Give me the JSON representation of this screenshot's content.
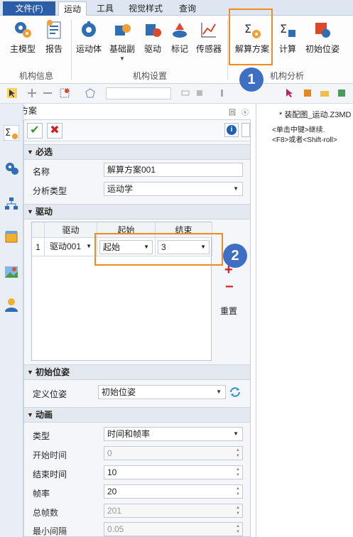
{
  "menu": {
    "file": "文件(F)",
    "tabs": [
      "运动",
      "工具",
      "视觉样式",
      "查询"
    ]
  },
  "ribbon": {
    "groups": [
      {
        "label": "机构信息",
        "buttons": [
          "主模型",
          "报告"
        ]
      },
      {
        "label": "机构设置",
        "buttons": [
          "运动体",
          "基础副",
          "驱动",
          "标记",
          "传感器"
        ]
      },
      {
        "label": "机构分析",
        "buttons": [
          "解算方案",
          "计算",
          "初始位姿"
        ]
      }
    ]
  },
  "panel": {
    "title": "解算方案",
    "controls": {
      "pin": "回",
      "close": "ⓧ"
    },
    "required": {
      "header": "必选",
      "name_label": "名称",
      "name_value": "解算方案001",
      "type_label": "分析类型",
      "type_value": "运动学"
    },
    "drive": {
      "header": "驱动",
      "columns": [
        "驱动",
        "起始",
        "结束"
      ],
      "rows": [
        {
          "index": "1",
          "drive": "驱动001",
          "start": "起始",
          "end": "3"
        }
      ],
      "reset_label": "重置"
    },
    "initial": {
      "header": "初始位姿",
      "define_label": "定义位姿",
      "define_value": "初始位姿"
    },
    "animation": {
      "header": "动画",
      "fields": [
        {
          "label": "类型",
          "value": "时间和帧率",
          "kind": "select",
          "disabled": false
        },
        {
          "label": "开始时间",
          "value": "0",
          "kind": "spin",
          "disabled": true
        },
        {
          "label": "结束时间",
          "value": "10",
          "kind": "spin",
          "disabled": false
        },
        {
          "label": "帧率",
          "value": "20",
          "kind": "spin",
          "disabled": false
        },
        {
          "label": "总帧数",
          "value": "201",
          "kind": "spin",
          "disabled": true
        },
        {
          "label": "最小间隔",
          "value": "0.05",
          "kind": "spin",
          "disabled": true
        }
      ]
    }
  },
  "document": {
    "title": "* 装配图_运动.Z3MD",
    "hints": [
      "<单击中键>继续.",
      "<F8>或者<Shift-roll>"
    ]
  },
  "callouts": [
    "1",
    "2"
  ],
  "colors": {
    "accent": "#f08c1e",
    "badge": "#3f6fc2",
    "file_tab": "#2b5ea7"
  }
}
